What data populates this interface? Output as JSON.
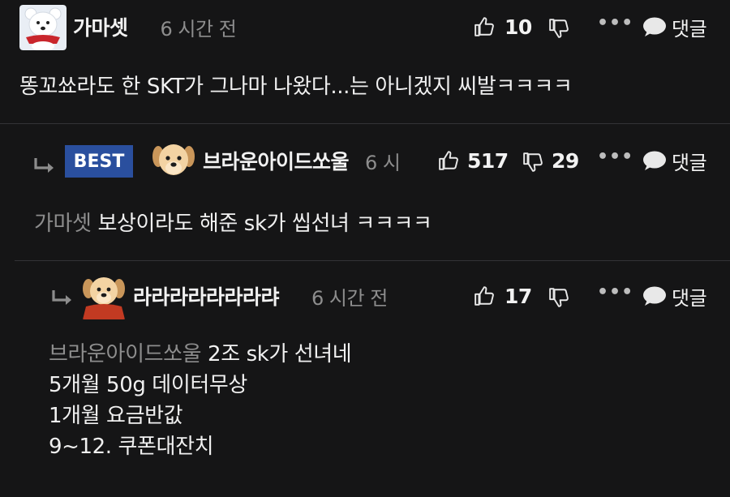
{
  "comments": [
    {
      "author": "가마셋",
      "time": "6 시간 전",
      "likes": "10",
      "reply_label": "댓글",
      "body": "똥꼬쑈라도 한 SKT가 그나마 나왔다...는 아니겠지 씨발ㅋㅋㅋㅋ"
    },
    {
      "badge": "BEST",
      "author": "브라운아이드쏘울",
      "time": "6 시",
      "likes": "517",
      "dislikes": "29",
      "reply_label": "댓글",
      "mention": "가마셋",
      "body": "보상이라도 해준 sk가 씹선녀 ㅋㅋㅋㅋ"
    },
    {
      "author": "라라라라라라라랴",
      "time": "6 시간 전",
      "likes": "17",
      "reply_label": "댓글",
      "mention": "브라운아이드쏘울",
      "body_lines": [
        "2조 sk가 선녀네",
        "5개월 50g 데이터무상",
        "1개월 요금반값",
        "9~12. 쿠폰대잔치"
      ]
    }
  ],
  "icons": {
    "like": "thumbs-up-icon",
    "dislike": "thumbs-down-icon",
    "more": "more-icon",
    "reply": "speech-bubble-icon",
    "reply_arrow": "reply-arrow-icon"
  },
  "colors": {
    "background": "#151516",
    "best_badge": "#2a4f9e",
    "muted_text": "#8d8d8d"
  }
}
